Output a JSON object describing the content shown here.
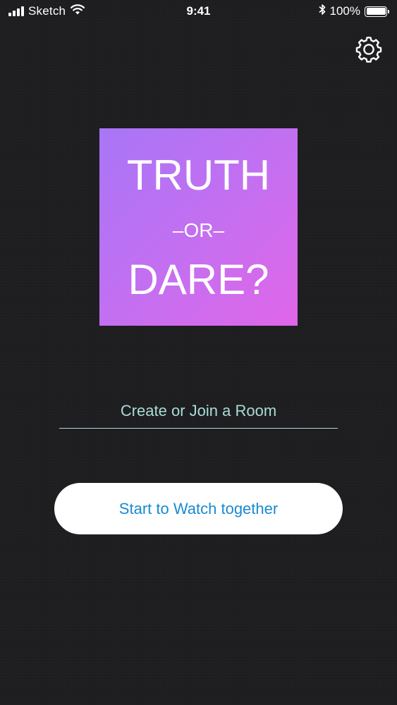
{
  "status_bar": {
    "carrier": "Sketch",
    "time": "9:41",
    "battery": "100%",
    "battery_level": 1.0,
    "icons": [
      "signal-icon",
      "wifi-icon",
      "bluetooth-icon",
      "battery-icon"
    ]
  },
  "header": {
    "settings_icon": "gear-icon"
  },
  "logo": {
    "line1": "TRUTH",
    "line2": "–OR–",
    "line3": "DARE?",
    "gradient_start": "#a876f7",
    "gradient_end": "#e066e8"
  },
  "room": {
    "value": "",
    "placeholder": "Create or Join a Room",
    "underline_color": "#a9dcd8"
  },
  "actions": {
    "start_label": "Start to Watch together",
    "start_text_color": "#1a8ad0"
  },
  "colors": {
    "background": "#1d1d1f"
  }
}
